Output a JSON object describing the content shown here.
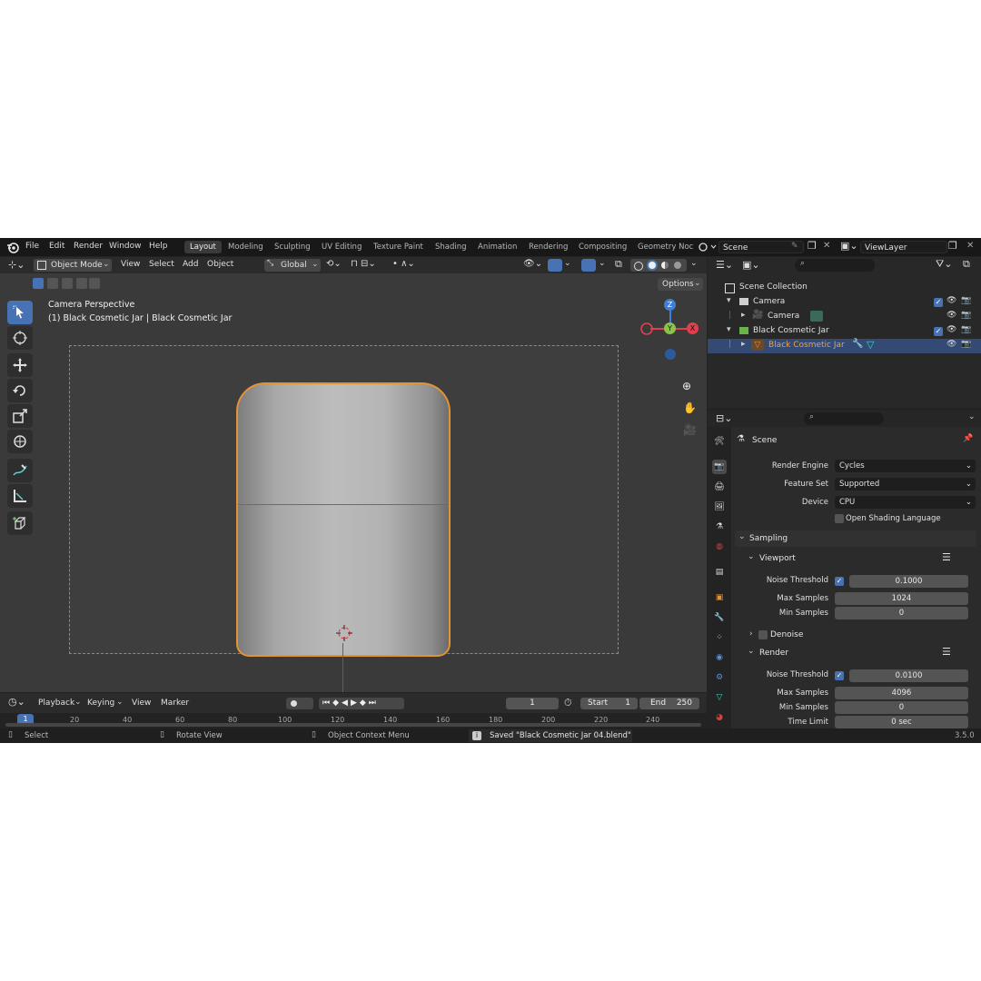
{
  "topbar": {
    "menus": [
      "File",
      "Edit",
      "Render",
      "Window",
      "Help"
    ],
    "workspaces": [
      "Layout",
      "Modeling",
      "Sculpting",
      "UV Editing",
      "Texture Paint",
      "Shading",
      "Animation",
      "Rendering",
      "Compositing",
      "Geometry Noc"
    ],
    "scene": "Scene",
    "view_layer": "ViewLayer"
  },
  "viewport": {
    "mode": "Object Mode",
    "menus": [
      "View",
      "Select",
      "Add",
      "Object"
    ],
    "orientation": "Global",
    "options": "Options",
    "camera_label": "Camera Perspective",
    "object_label": "(1) Black Cosmetic Jar | Black Cosmetic Jar",
    "gizmo": {
      "z": "Z",
      "y": "Y",
      "x": "X"
    }
  },
  "timeline": {
    "menus": [
      "Playback",
      "Keying",
      "View",
      "Marker"
    ],
    "current_frame": "1",
    "start_label": "Start",
    "start": "1",
    "end_label": "End",
    "end": "250",
    "ticks": [
      "1",
      "20",
      "40",
      "60",
      "80",
      "100",
      "120",
      "140",
      "160",
      "180",
      "200",
      "220",
      "240"
    ]
  },
  "statusbar": {
    "select": "Select",
    "rotate": "Rotate View",
    "context": "Object Context Menu",
    "message": "Saved \"Black Cosmetic Jar 04.blend\"",
    "version": "3.5.0"
  },
  "outliner": {
    "root": "Scene Collection",
    "rows": [
      {
        "label": "Camera",
        "level": 1
      },
      {
        "label": "Camera",
        "level": 2
      },
      {
        "label": "Black Cosmetic Jar",
        "level": 1
      },
      {
        "label": "Black Cosmetic Jar",
        "level": 2
      }
    ]
  },
  "properties": {
    "context": "Scene",
    "render_engine_label": "Render Engine",
    "render_engine": "Cycles",
    "feature_set_label": "Feature Set",
    "feature_set": "Supported",
    "device_label": "Device",
    "device": "CPU",
    "osl_label": "Open Shading Language",
    "sampling": "Sampling",
    "viewport": "Viewport",
    "render": "Render",
    "denoise": "Denoise",
    "vp_noise_label": "Noise Threshold",
    "vp_noise": "0.1000",
    "vp_max_label": "Max Samples",
    "vp_max": "1024",
    "vp_min_label": "Min Samples",
    "vp_min": "0",
    "r_noise_label": "Noise Threshold",
    "r_noise": "0.0100",
    "r_max_label": "Max Samples",
    "r_max": "4096",
    "r_min_label": "Min Samples",
    "r_min": "0",
    "time_limit_label": "Time Limit",
    "time_limit": "0 sec"
  },
  "colors": {
    "accent": "#4772b3",
    "selection_outline": "#e39236",
    "gizmo_x": "#e0404e",
    "gizmo_y": "#8bc34a",
    "gizmo_z": "#3f7fd6"
  }
}
